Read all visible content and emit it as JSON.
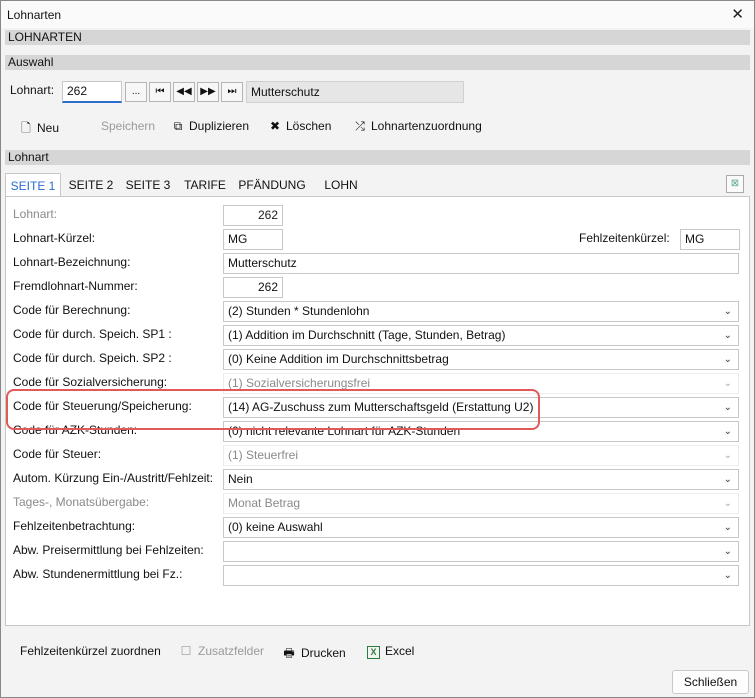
{
  "window": {
    "title": "Lohnarten",
    "header": "LOHNARTEN"
  },
  "auswahl": {
    "section": "Auswahl",
    "label": "Lohnart:",
    "value": "262",
    "browse": "...",
    "name": "Mutterschutz"
  },
  "toolbar": {
    "new": "Neu",
    "save": "Speichern",
    "duplicate": "Duplizieren",
    "delete": "Löschen",
    "assign": "Lohnartenzuordnung"
  },
  "lohnart_section": "Lohnart",
  "tabs": [
    "SEITE 1",
    "SEITE 2",
    "SEITE 3",
    "TARIFE",
    "PFÄNDUNG",
    "LOHN"
  ],
  "form": {
    "lohnart_label": "Lohnart:",
    "lohnart_value": "262",
    "kuerzel_label": "Lohnart-Kürzel:",
    "kuerzel_value": "MG",
    "fehlzeiten_kuerzel_label": "Fehlzeitenkürzel:",
    "fehlzeiten_kuerzel_value": "MG",
    "bezeichnung_label": "Lohnart-Bezeichnung:",
    "bezeichnung_value": "Mutterschutz",
    "fremd_label": "Fremdlohnart-Nummer:",
    "fremd_value": "262",
    "rows": [
      {
        "label": "Code für Berechnung:",
        "value": "(2) Stunden * Stundenlohn"
      },
      {
        "label": "Code für durch. Speich. SP1 :",
        "value": "(1) Addition im Durchschnitt (Tage, Stunden, Betrag)"
      },
      {
        "label": "Code für durch. Speich. SP2 :",
        "value": "(0) Keine Addition im Durchschnittsbetrag"
      },
      {
        "label": "Code für Sozialversicherung:",
        "value": "(1) Sozialversicherungsfrei"
      },
      {
        "label": "Code für Steuerung/Speicherung:",
        "value": "(14) AG-Zuschuss zum Mutterschaftsgeld (Erstattung U2)"
      },
      {
        "label": "Code für AZK-Stunden:",
        "value": "(0) nicht relevante Lohnart für AZK-Stunden"
      },
      {
        "label": "Code für Steuer:",
        "value": "(1) Steuerfrei"
      },
      {
        "label": "Autom. Kürzung Ein-/Austritt/Fehlzeit:",
        "value": "Nein"
      },
      {
        "label": "Tages-, Monatsübergabe:",
        "value": "Monat Betrag"
      },
      {
        "label": "Fehlzeitenbetrachtung:",
        "value": "(0) keine Auswahl"
      },
      {
        "label": "Abw. Preisermittlung bei Fehlzeiten:",
        "value": ""
      },
      {
        "label": "Abw. Stundenermittlung bei Fz.:",
        "value": ""
      }
    ]
  },
  "bottom": {
    "assign_absence": "Fehlzeitenkürzel zuordnen",
    "extra_fields": "Zusatzfelder",
    "print": "Drucken",
    "excel": "Excel",
    "close": "Schließen"
  }
}
